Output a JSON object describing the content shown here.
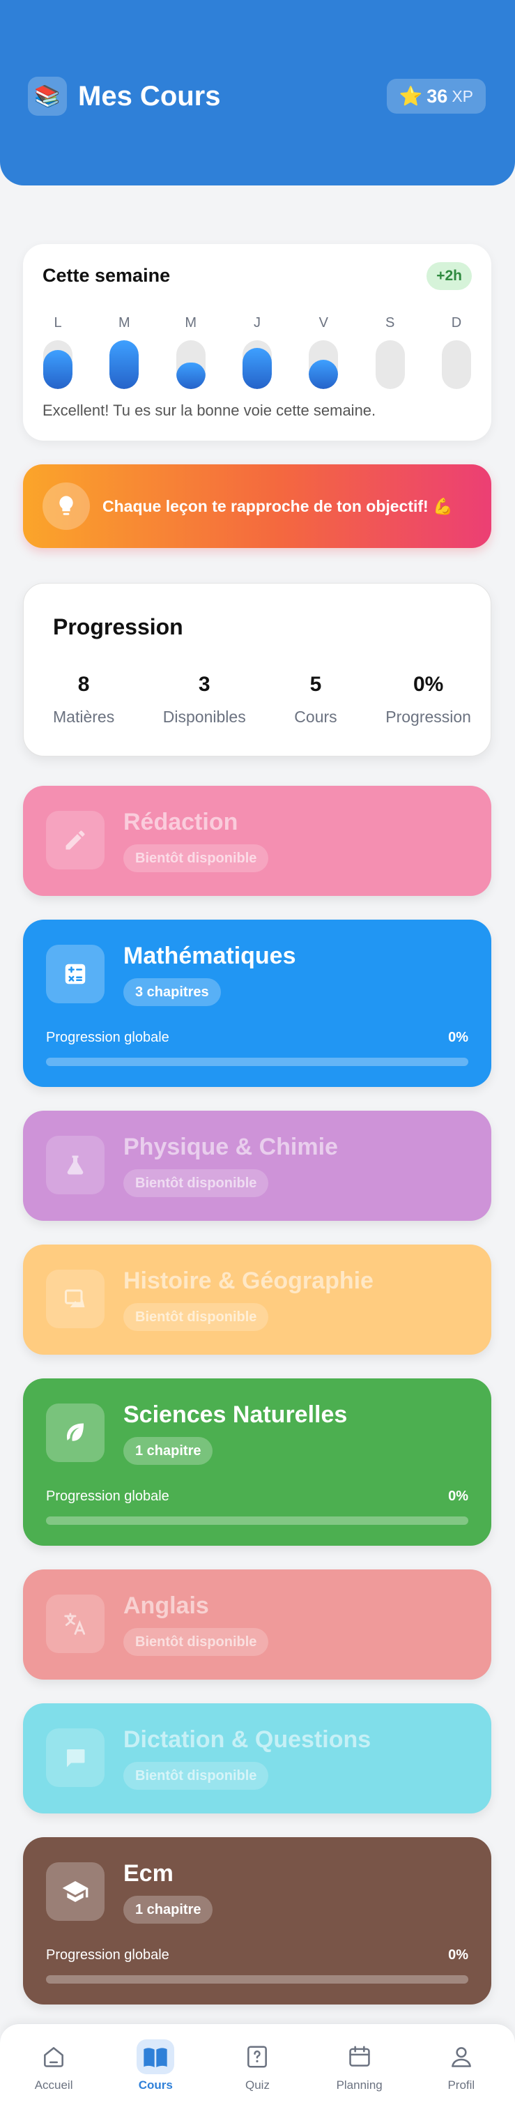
{
  "header": {
    "title": "Mes Cours",
    "logo_icon": "books-emoji",
    "xp_icon": "star-emoji",
    "xp_value": "36",
    "xp_unit": "XP",
    "color": "#2f80d8"
  },
  "week": {
    "title": "Cette semaine",
    "badge": "+2h",
    "days": [
      {
        "label": "L",
        "level": 0.8
      },
      {
        "label": "M",
        "level": 1.0
      },
      {
        "label": "M",
        "level": 0.55
      },
      {
        "label": "J",
        "level": 0.85
      },
      {
        "label": "V",
        "level": 0.6
      },
      {
        "label": "S",
        "level": 0
      },
      {
        "label": "D",
        "level": 0
      }
    ],
    "message": "Excellent! Tu es sur la bonne voie cette semaine."
  },
  "banner": {
    "text": "Chaque leçon te rapproche de ton objectif! 💪"
  },
  "progression": {
    "title": "Progression",
    "stats": [
      {
        "value": "8",
        "label": "Matières"
      },
      {
        "value": "3",
        "label": "Disponibles"
      },
      {
        "value": "5",
        "label": "Cours"
      },
      {
        "value": "0%",
        "label": "Progression"
      }
    ]
  },
  "subjects": [
    {
      "name": "Rédaction",
      "tag": "Bientôt disponible",
      "available": false,
      "color": "#f48fb1",
      "icon": "pencil-icon"
    },
    {
      "name": "Mathématiques",
      "tag": "3 chapitres",
      "available": true,
      "color": "#2196f3",
      "icon": "calculator-icon",
      "progress_label": "Progression globale",
      "progress_value": "0%",
      "progress": 0
    },
    {
      "name": "Physique & Chimie",
      "tag": "Bientôt disponible",
      "available": false,
      "color": "#ce93d8",
      "icon": "flask-icon"
    },
    {
      "name": "Histoire & Géographie",
      "tag": "Bientôt disponible",
      "available": false,
      "color": "#ffcc80",
      "icon": "map-icon"
    },
    {
      "name": "Sciences Naturelles",
      "tag": "1 chapitre",
      "available": true,
      "color": "#4caf50",
      "icon": "leaf-icon",
      "progress_label": "Progression globale",
      "progress_value": "0%",
      "progress": 0
    },
    {
      "name": "Anglais",
      "tag": "Bientôt disponible",
      "available": false,
      "color": "#ef9a9a",
      "icon": "translate-icon"
    },
    {
      "name": "Dictation & Questions",
      "tag": "Bientôt disponible",
      "available": false,
      "color": "#80deea",
      "icon": "chat-bubble-icon"
    },
    {
      "name": "Ecm",
      "tag": "1 chapitre",
      "available": true,
      "color": "#795548",
      "icon": "graduation-cap-icon",
      "progress_label": "Progression globale",
      "progress_value": "0%",
      "progress": 0
    }
  ],
  "nav": {
    "items": [
      {
        "label": "Accueil",
        "icon": "home-icon",
        "active": false
      },
      {
        "label": "Cours",
        "icon": "book-icon",
        "active": true
      },
      {
        "label": "Quiz",
        "icon": "quiz-icon",
        "active": false
      },
      {
        "label": "Planning",
        "icon": "calendar-icon",
        "active": false
      },
      {
        "label": "Profil",
        "icon": "user-icon",
        "active": false
      }
    ]
  }
}
